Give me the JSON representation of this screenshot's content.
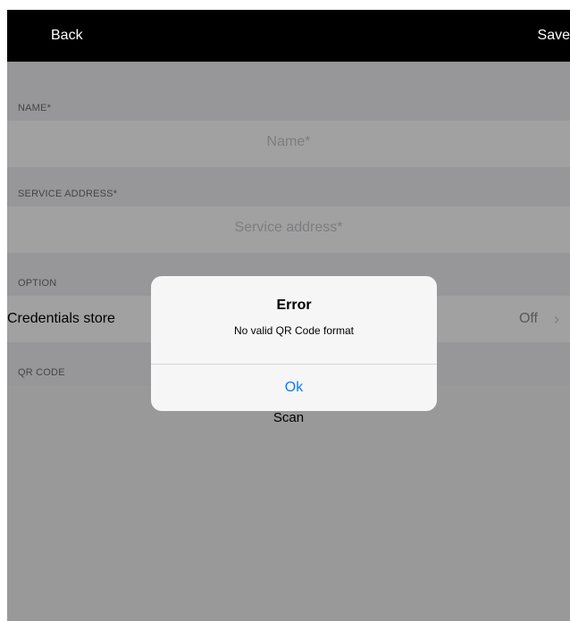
{
  "navbar": {
    "back_label": "Back",
    "save_label": "Save"
  },
  "form": {
    "name_header": "NAME*",
    "name_placeholder": "Name*",
    "service_header": "SERVICE ADDRESS*",
    "service_placeholder": "Service address*",
    "option_header": "OPTION",
    "credentials_label": "Credentials store",
    "credentials_value": "Off",
    "qr_header": "QR CODE",
    "scan_label": "Scan"
  },
  "alert": {
    "title": "Error",
    "message": "No valid QR Code format",
    "button_label": "Ok"
  },
  "icons": {
    "chevron": "chevron-right-icon"
  },
  "colors": {
    "navbar": "#000000",
    "accent": "#0a7cff",
    "placeholder": "#c7c7cd"
  }
}
